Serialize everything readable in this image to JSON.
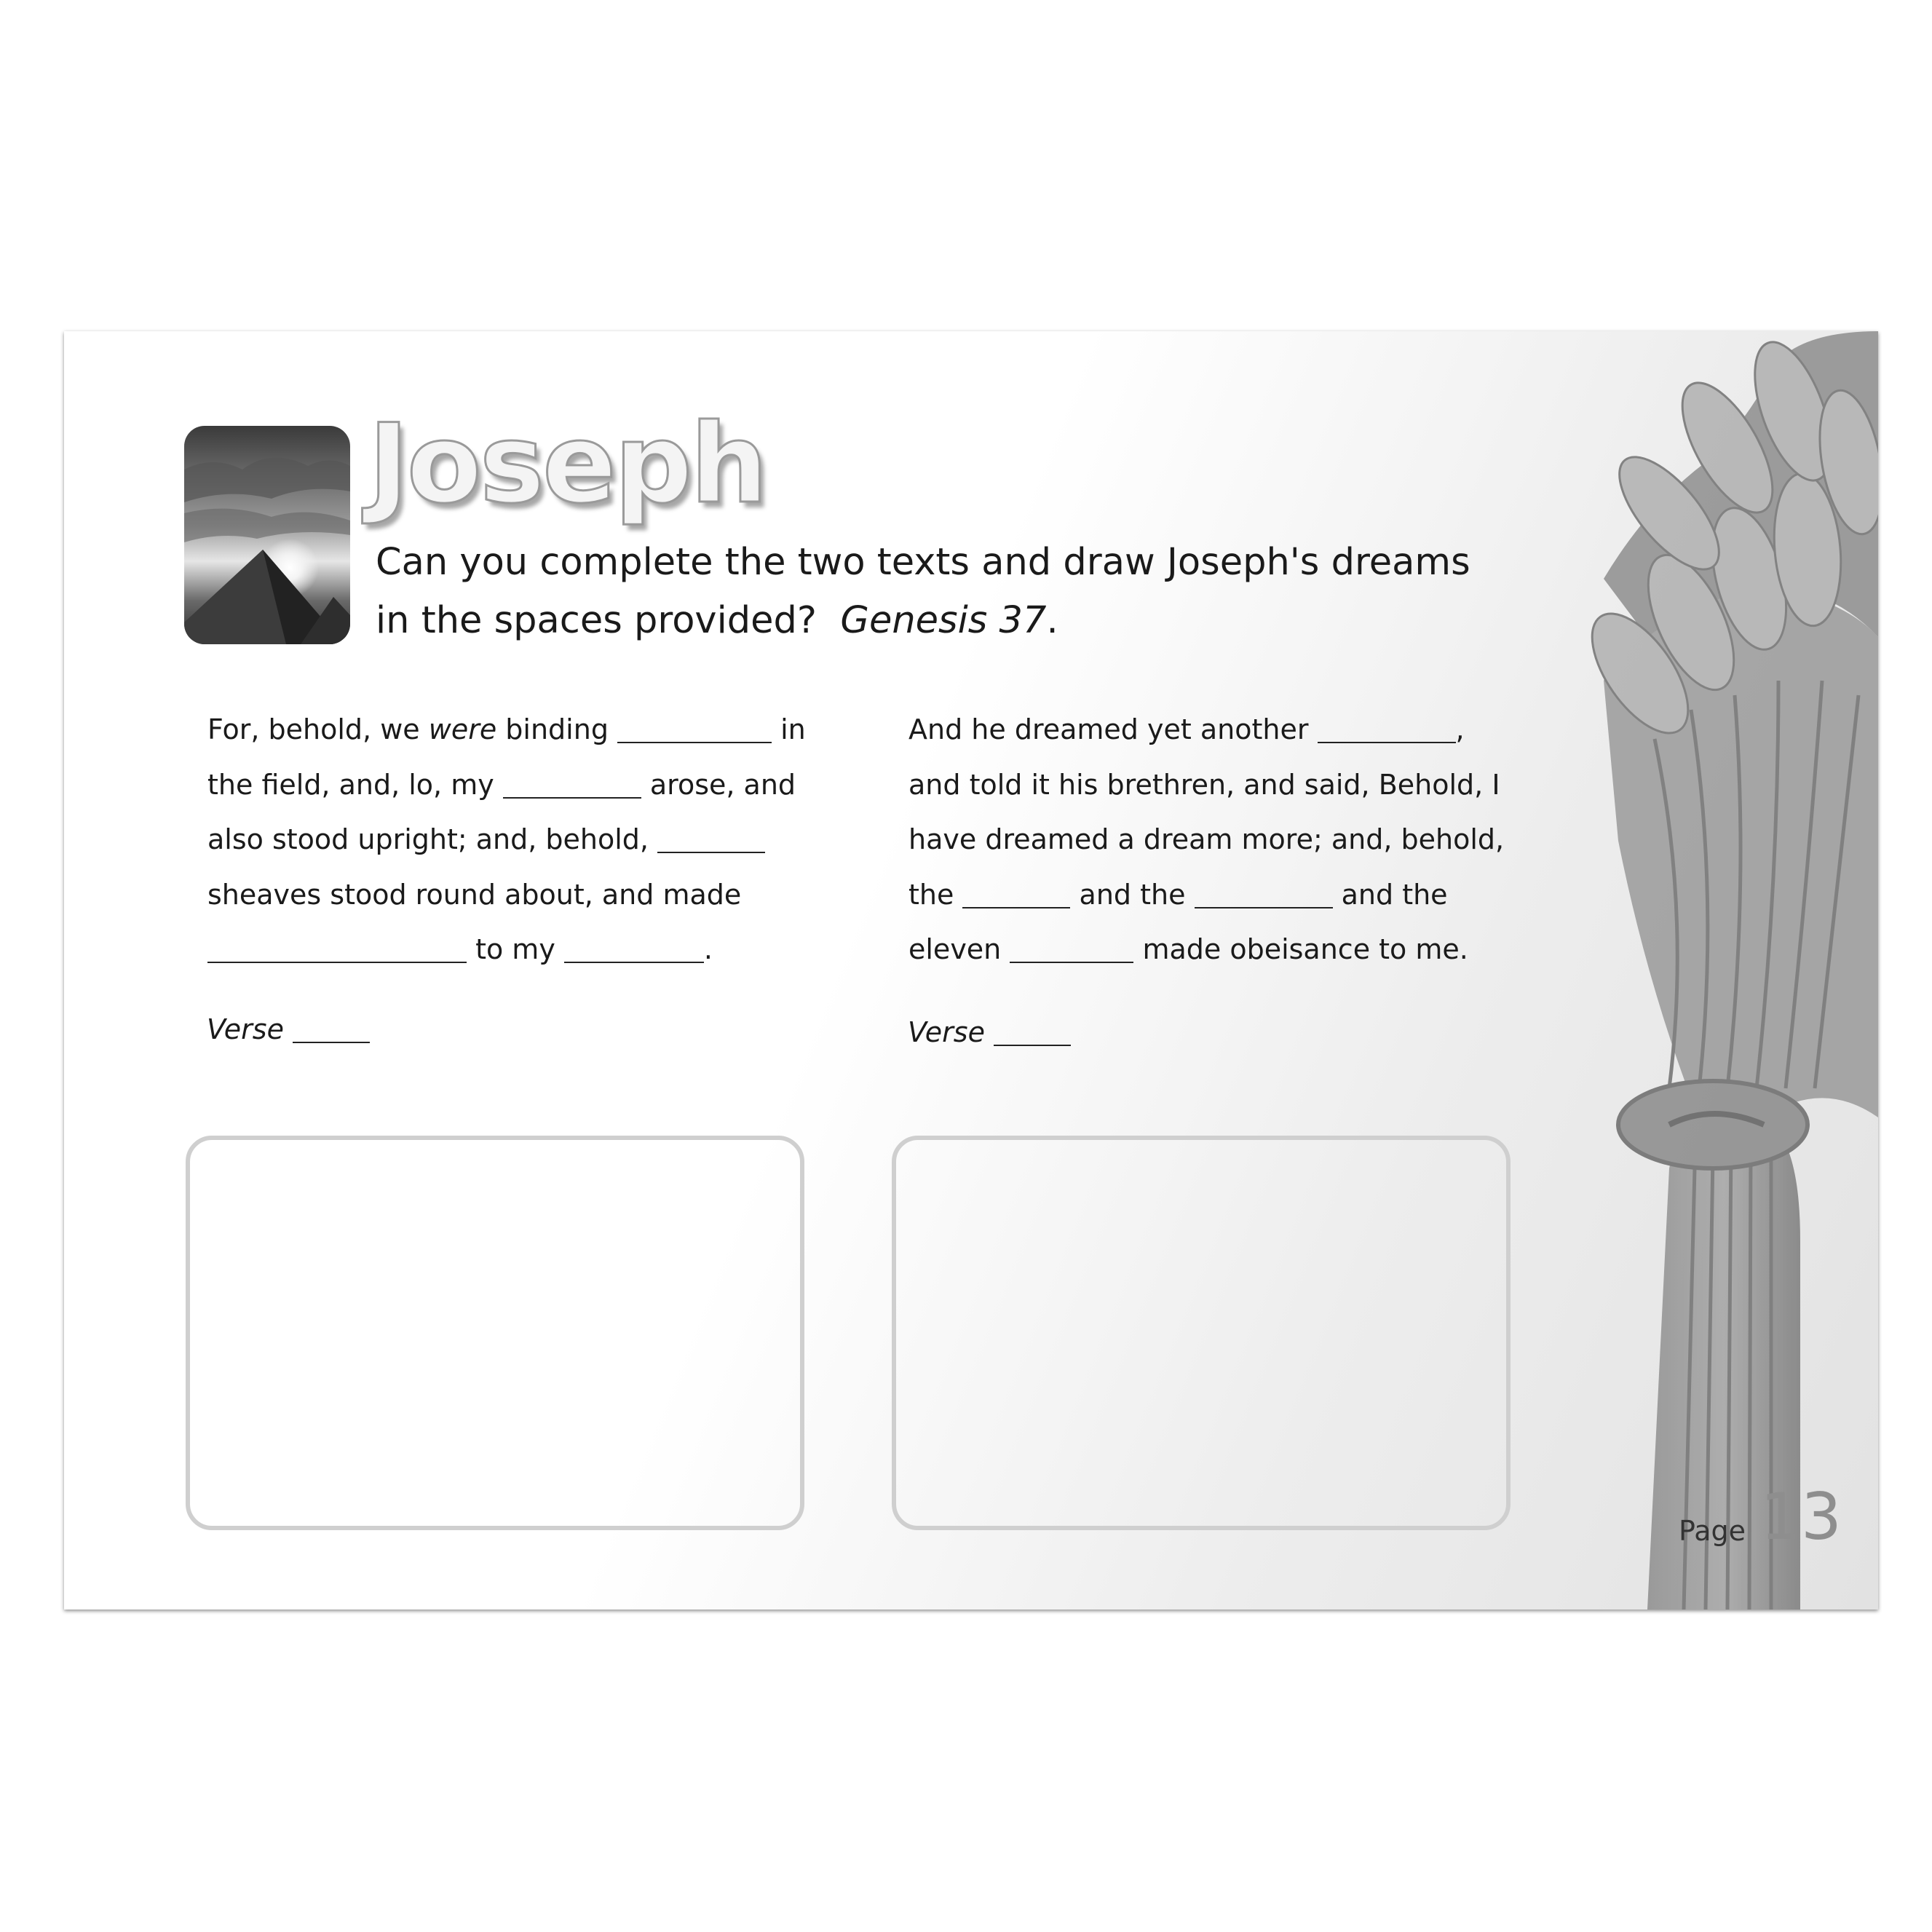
{
  "title": "Joseph",
  "instructions": {
    "line1": "Can you complete the two texts and draw Joseph's dreams",
    "line2": "in the spaces provided?",
    "reference": "Genesis 37",
    "reference_end": "."
  },
  "left_passage": {
    "l1a": "For, behold, we ",
    "l1b": "were",
    "l1c": " binding ",
    "l1d": " in",
    "l2a": "the field, and, lo, my ",
    "l2b": " arose, and",
    "l3a": "also stood upright; and, behold, ",
    "l4": "sheaves stood round about, and made",
    "l5a": " to my ",
    "l5b": "."
  },
  "right_passage": {
    "l1a": "And he dreamed yet another ",
    "l1b": ",",
    "l2": "and told it his brethren, and said, Behold, I",
    "l3": "have dreamed a dream more; and, behold,",
    "l4a": "the ",
    "l4b": " and the ",
    "l4c": " and the",
    "l5a": "eleven ",
    "l5b": " made obeisance to me."
  },
  "verse_label": "Verse",
  "footer": {
    "page_label": "Page",
    "page_number": "13"
  },
  "icons": {
    "thumbnail": "pyramid-sunset-photo",
    "background": "wheat-sheaf-image"
  }
}
